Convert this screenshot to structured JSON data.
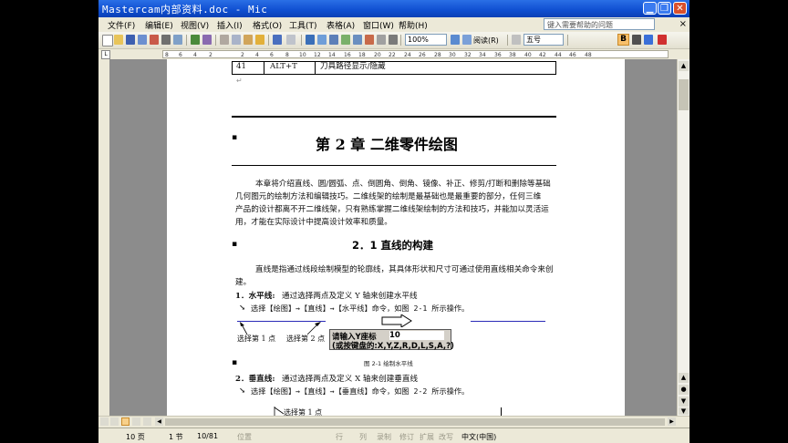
{
  "window": {
    "title": "Mastercam内部资料.doc - Mic"
  },
  "menubar": {
    "items": [
      "文件(F)",
      "编辑(E)",
      "视图(V)",
      "插入(I)",
      "格式(O)",
      "工具(T)",
      "表格(A)",
      "窗口(W)",
      "帮助(H)"
    ],
    "help_placeholder": "键入需要帮助的问题",
    "close_glyph": "×"
  },
  "toolbar": {
    "zoom": "100%",
    "read_label": "阅读(R)",
    "font_size": "五号",
    "bold_label": "B"
  },
  "ruler": {
    "numbers": [
      "8",
      "6",
      "4",
      "2",
      "",
      "2",
      "4",
      "6",
      "8",
      "10",
      "12",
      "14",
      "16",
      "18",
      "20",
      "22",
      "24",
      "26",
      "28",
      "30",
      "32",
      "34",
      "36",
      "38",
      "40",
      "42",
      "44",
      "46",
      "48"
    ]
  },
  "document": {
    "table_row": {
      "num": "41",
      "keys": "ALT+T",
      "desc": "刀具路径显示/隐藏"
    },
    "chapter_title": "第 2 章      二维零件绘图",
    "intro": [
      "本章将介绍直线、圆/圆弧、点、倒圆角、倒角、镜像、补正、修剪/打断和删除等基础",
      "几何图元的绘制方法和编辑技巧。二维线架的绘制是最基础也是最重要的部分，任何三维",
      "产品的设计都离不开二维线架，只有熟练掌握二维线架绘制的方法和技巧，并能加以灵活运",
      "用，才能在实际设计中提高设计效率和质量。"
    ],
    "section_title": "2．1  直线的构建",
    "section_intro": [
      "直线是指通过线段绘制模型的轮廓线，其具体形状和尺寸可通过使用直线相关命令来创",
      "建。"
    ],
    "item1": {
      "head": "1．水平线:",
      "text": "通过选择两点及定义 Y 轴来创建水平线",
      "step": "选择【绘图】→【直线】→【水平线】命令，如图 2-1 所示操作。"
    },
    "figure1": {
      "label_p1": "选择第 1 点",
      "label_p2": "选择第 2 点",
      "prompt_line1": "请输入Y座标",
      "prompt_value": "10",
      "prompt_line2": "(或按键盘的:X,Y,Z,R,D,L,S,A,?)",
      "caption": "图 2-1  绘制水平线"
    },
    "item2": {
      "head": "2．垂直线:",
      "text": "通过选择两点及定义 X 轴来创建垂直线",
      "step": "选择【绘图】→【直线】→【垂直线】命令，如图 2-2 所示操作。"
    },
    "figure2": {
      "label_p1": "选择第 1 点"
    },
    "para_mark": "↵",
    "arrow_mark": "↘"
  },
  "statusbar": {
    "page": "10 页",
    "section": "1 节",
    "position": "10/81",
    "at": "位置",
    "line": "行",
    "col": "列",
    "rec": "录制",
    "trk": "修订",
    "ext": "扩展",
    "ovr": "改写",
    "lang": "中文(中国)"
  },
  "colors": {
    "title_bar": "#0f4ed0",
    "window_bg": "#ece9d8",
    "doc_bg": "#8c8c8c",
    "line_blue": "#2b2bb8"
  }
}
